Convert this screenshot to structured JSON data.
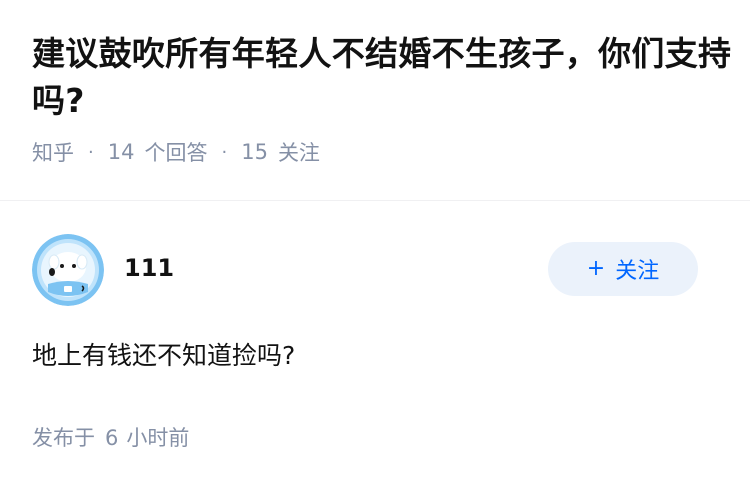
{
  "question": {
    "title": "建议鼓吹所有年轻人不结婚不生孩子，你们支持吗?",
    "source": "知乎",
    "answer_count": "14",
    "answer_label": "个回答",
    "follower_count": "15",
    "follower_label": "关注"
  },
  "answer": {
    "author": "111",
    "follow_label": "关注",
    "content": "地上有钱还不知道捡吗?",
    "time_prefix": "发布于",
    "time_value": "6",
    "time_suffix": "小时前"
  },
  "colors": {
    "accent": "#0066ff",
    "meta": "#8590a6",
    "follow_bg": "#ebf2fb"
  }
}
